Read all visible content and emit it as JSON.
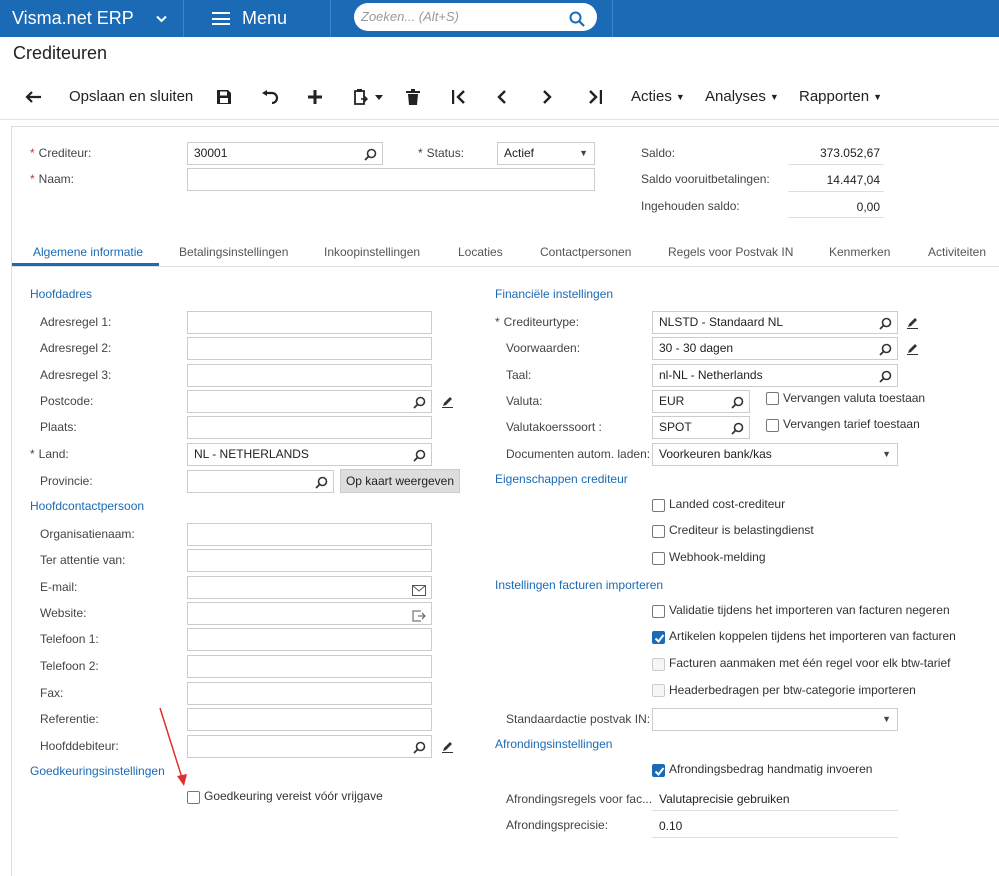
{
  "app": {
    "brand": "Visma.net ERP",
    "menu": "Menu",
    "search_placeholder": "Zoeken... (Alt+S)"
  },
  "page": {
    "title": "Crediteuren"
  },
  "toolbar": {
    "save_close": "Opslaan en sluiten",
    "acties": "Acties",
    "analyses": "Analyses",
    "rapporten": "Rapporten"
  },
  "header": {
    "crediteur_label": "Crediteur:",
    "crediteur_value": "30001",
    "naam_label": "Naam:",
    "naam_value": "",
    "status_label": "Status:",
    "status_value": "Actief",
    "saldo_label": "Saldo:",
    "saldo_value": "373.052,67",
    "vooruit_label": "Saldo vooruitbetalingen:",
    "vooruit_value": "14.447,04",
    "ingehouden_label": "Ingehouden saldo:",
    "ingehouden_value": "0,00"
  },
  "tabs": [
    "Algemene informatie",
    "Betalingsinstellingen",
    "Inkoopinstellingen",
    "Locaties",
    "Contactpersonen",
    "Regels voor Postvak IN",
    "Kenmerken",
    "Activiteiten"
  ],
  "left": {
    "hoofdadres": "Hoofdadres",
    "adres1": "Adresregel 1:",
    "adres2": "Adresregel 2:",
    "adres3": "Adresregel 3:",
    "postcode": "Postcode:",
    "plaats": "Plaats:",
    "land": "Land:",
    "land_value": "NL - NETHERLANDS",
    "provincie": "Provincie:",
    "kaart_btn": "Op kaart weergeven",
    "hoofdcontact": "Hoofdcontactpersoon",
    "organisatie": "Organisatienaam:",
    "attentie": "Ter attentie van:",
    "email": "E-mail:",
    "website": "Website:",
    "tel1": "Telefoon 1:",
    "tel2": "Telefoon 2:",
    "fax": "Fax:",
    "referentie": "Referentie:",
    "hoofddebiteur": "Hoofddebiteur:",
    "goedkeuring_sect": "Goedkeuringsinstellingen",
    "goedkeuring_cb": "Goedkeuring vereist vóór vrijgave"
  },
  "right": {
    "fin": "Financiële instellingen",
    "type_label": "Crediteurtype:",
    "type_value": "NLSTD - Standaard NL",
    "voorw_label": "Voorwaarden:",
    "voorw_value": "30 - 30 dagen",
    "taal_label": "Taal:",
    "taal_value": "nl-NL - Netherlands",
    "valuta_label": "Valuta:",
    "valuta_value": "EUR",
    "valuta_cb": "Vervangen valuta toestaan",
    "koers_label": "Valutakoerssoort :",
    "koers_value": "SPOT",
    "koers_cb": "Vervangen tarief toestaan",
    "docs_label": "Documenten autom. laden:",
    "docs_value": "Voorkeuren bank/kas",
    "eig": "Eigenschappen crediteur",
    "landed": "Landed cost-crediteur",
    "belasting": "Crediteur is belastingdienst",
    "webhook": "Webhook-melding",
    "import": "Instellingen facturen importeren",
    "validatie": "Validatie tijdens het importeren van facturen negeren",
    "artikelen": "Artikelen koppelen tijdens het importeren van facturen",
    "facturen_regel": "Facturen aanmaken met één regel voor elk btw-tarief",
    "header_btw": "Headerbedragen per btw-categorie importeren",
    "postvak_label": "Standaardactie postvak IN:",
    "postvak_value": "",
    "afr": "Afrondingsinstellingen",
    "afr_cb": "Afrondingsbedrag handmatig invoeren",
    "afr_regels_label": "Afrondingsregels voor fac...",
    "afr_regels_value": "Valutaprecisie gebruiken",
    "afr_prec_label": "Afrondingsprecisie:",
    "afr_prec_value": "0.10"
  },
  "colors": {
    "brand": "#1b6ab5",
    "annotation_arrow": "#e03030"
  }
}
